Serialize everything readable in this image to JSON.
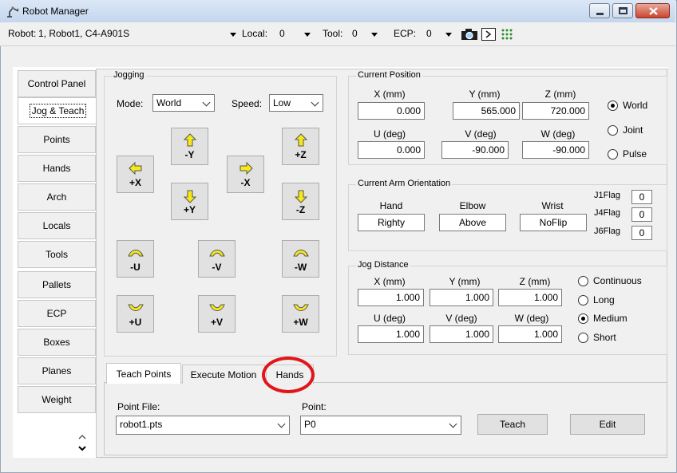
{
  "window": {
    "title": "Robot Manager"
  },
  "toolbar": {
    "robot_label": "Robot:",
    "robot_value": "1, Robot1, C4-A901S",
    "local_label": "Local:",
    "local_value": "0",
    "tool_label": "Tool:",
    "tool_value": "0",
    "ecp_label": "ECP:",
    "ecp_value": "0"
  },
  "sidebar": {
    "items": [
      {
        "label": "Control Panel"
      },
      {
        "label": "Jog & Teach"
      },
      {
        "label": "Points"
      },
      {
        "label": "Hands"
      },
      {
        "label": "Arch"
      },
      {
        "label": "Locals"
      },
      {
        "label": "Tools"
      },
      {
        "label": "Pallets"
      },
      {
        "label": "ECP"
      },
      {
        "label": "Boxes"
      },
      {
        "label": "Planes"
      },
      {
        "label": "Weight"
      }
    ],
    "active_index": 1
  },
  "jogging": {
    "title": "Jogging",
    "mode_label": "Mode:",
    "mode_value": "World",
    "speed_label": "Speed:",
    "speed_value": "Low",
    "buttons": {
      "plus_x": "+X",
      "minus_y": "-Y",
      "plus_y": "+Y",
      "minus_x": "-X",
      "plus_z": "+Z",
      "minus_z": "-Z",
      "minus_u": "-U",
      "minus_v": "-V",
      "minus_w": "-W",
      "plus_u": "+U",
      "plus_v": "+V",
      "plus_w": "+W"
    }
  },
  "current_position": {
    "title": "Current Position",
    "x_label": "X (mm)",
    "x_value": "0.000",
    "y_label": "Y (mm)",
    "y_value": "565.000",
    "z_label": "Z (mm)",
    "z_value": "720.000",
    "u_label": "U (deg)",
    "u_value": "0.000",
    "v_label": "V (deg)",
    "v_value": "-90.000",
    "w_label": "W (deg)",
    "w_value": "-90.000",
    "modes": [
      "World",
      "Joint",
      "Pulse"
    ],
    "selected_mode": "World"
  },
  "arm_orientation": {
    "title": "Current Arm Orientation",
    "hand_label": "Hand",
    "hand_value": "Righty",
    "elbow_label": "Elbow",
    "elbow_value": "Above",
    "wrist_label": "Wrist",
    "wrist_value": "NoFlip",
    "j1_label": "J1Flag",
    "j1_value": "0",
    "j4_label": "J4Flag",
    "j4_value": "0",
    "j6_label": "J6Flag",
    "j6_value": "0"
  },
  "jog_distance": {
    "title": "Jog Distance",
    "x_label": "X (mm)",
    "x_value": "1.000",
    "y_label": "Y (mm)",
    "y_value": "1.000",
    "z_label": "Z (mm)",
    "z_value": "1.000",
    "u_label": "U (deg)",
    "u_value": "1.000",
    "v_label": "V (deg)",
    "v_value": "1.000",
    "w_label": "W (deg)",
    "w_value": "1.000",
    "modes": [
      "Continuous",
      "Long",
      "Medium",
      "Short"
    ],
    "selected_mode": "Medium"
  },
  "bottom_tabs": {
    "tabs": [
      "Teach Points",
      "Execute Motion",
      "Hands"
    ],
    "active_index": 0
  },
  "teach_points": {
    "point_file_label": "Point File:",
    "point_file_value": "robot1.pts",
    "point_label": "Point:",
    "point_value": "P0",
    "teach_button": "Teach",
    "edit_button": "Edit"
  },
  "colors": {
    "arrow_fill": "#f7e817",
    "highlight": "#e0161b"
  }
}
